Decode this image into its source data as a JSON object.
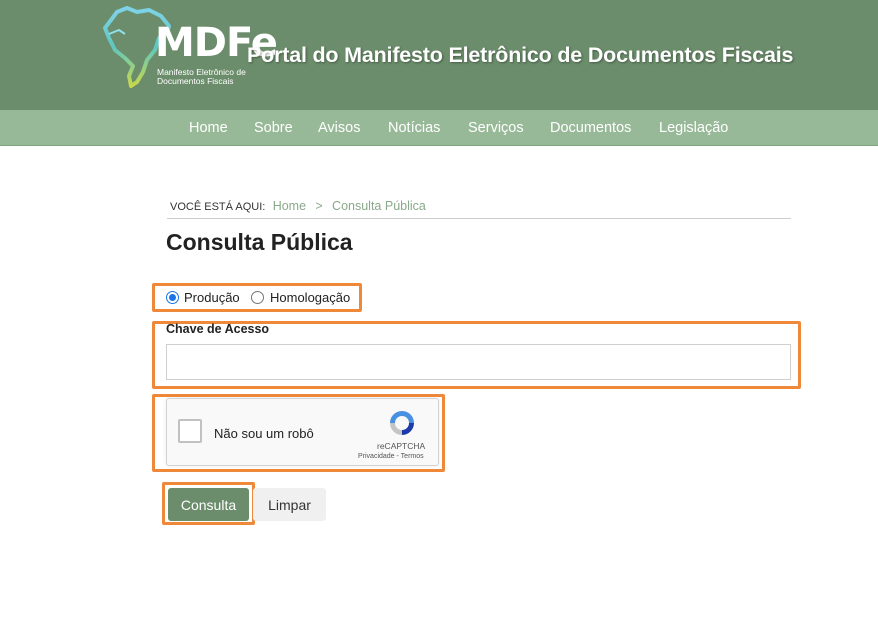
{
  "header": {
    "logo_text": "MDFe",
    "logo_subtitle_line1": "Manifesto Eletrônico de",
    "logo_subtitle_line2": "Documentos Fiscais",
    "portal_title": "Portal do Manifesto Eletrônico de Documentos Fiscais"
  },
  "nav": {
    "items": [
      {
        "label": "Home"
      },
      {
        "label": "Sobre"
      },
      {
        "label": "Avisos"
      },
      {
        "label": "Notícias"
      },
      {
        "label": "Serviços"
      },
      {
        "label": "Documentos"
      },
      {
        "label": "Legislação"
      }
    ]
  },
  "breadcrumb": {
    "prefix": "VOCÊ ESTÁ AQUI:",
    "home": "Home",
    "separator": ">",
    "current": "Consulta Pública"
  },
  "page": {
    "title": "Consulta Pública"
  },
  "environment": {
    "options": [
      {
        "label": "Produção",
        "checked": true
      },
      {
        "label": "Homologação",
        "checked": false
      }
    ]
  },
  "access_key": {
    "label": "Chave de Acesso",
    "value": ""
  },
  "captcha": {
    "text": "Não sou um robô",
    "brand": "reCAPTCHA",
    "links": "Privacidade - Termos"
  },
  "actions": {
    "consulta_label": "Consulta",
    "limpar_label": "Limpar"
  },
  "colors": {
    "header_bg": "#6b8d6b",
    "nav_bg": "#98b998",
    "highlight": "#f0883a",
    "primary_button": "#6b8d6b"
  }
}
